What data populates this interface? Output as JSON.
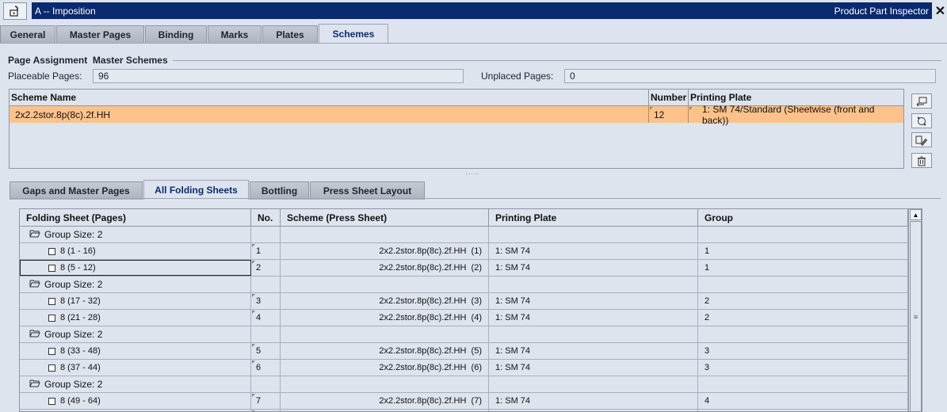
{
  "window": {
    "title": "A -- Imposition",
    "inspector_label": "Product Part Inspector",
    "lock_icon": "lock-open-icon",
    "close_glyph": "✕"
  },
  "main_tabs": [
    {
      "label": "General"
    },
    {
      "label": "Master Pages"
    },
    {
      "label": "Binding"
    },
    {
      "label": "Marks"
    },
    {
      "label": "Plates"
    },
    {
      "label": "Schemes"
    }
  ],
  "page_assignment": {
    "title": "Page Assignment  Master Schemes",
    "placeable_label": "Placeable Pages:",
    "placeable_value": "96",
    "unplaced_label": "Unplaced Pages:",
    "unplaced_value": "0"
  },
  "scheme_table": {
    "headers": [
      "Scheme Name",
      "Number",
      "Printing Plate"
    ],
    "rows": [
      {
        "name": "2x2.2stor.8p(8c).2f.HH",
        "number": "12",
        "plate": "1: SM 74/Standard (Sheetwise (front and back))"
      }
    ]
  },
  "side_buttons": [
    "swap-icon",
    "refresh-icon",
    "edit-icon",
    "trash-icon"
  ],
  "splitter_glyph": "·····",
  "sub_tabs": [
    {
      "label": "Gaps and Master Pages"
    },
    {
      "label": "All Folding Sheets"
    },
    {
      "label": "Bottling"
    },
    {
      "label": "Press Sheet Layout"
    }
  ],
  "folding_table": {
    "headers": [
      "Folding Sheet (Pages)",
      "No.",
      "Scheme (Press Sheet)",
      "Printing Plate",
      "Group"
    ],
    "rows": [
      {
        "type": "group",
        "label": "Group Size: 2"
      },
      {
        "type": "item",
        "pages": "8 (1 - 16)",
        "no": "1",
        "scheme": "2x2.2stor.8p(8c).2f.HH  (1)",
        "plate": "1: SM 74",
        "group": "1"
      },
      {
        "type": "item",
        "pages": "8 (5 - 12)",
        "no": "2",
        "scheme": "2x2.2stor.8p(8c).2f.HH  (2)",
        "plate": "1: SM 74",
        "group": "1"
      },
      {
        "type": "group",
        "label": "Group Size: 2"
      },
      {
        "type": "item",
        "pages": "8 (17 - 32)",
        "no": "3",
        "scheme": "2x2.2stor.8p(8c).2f.HH  (3)",
        "plate": "1: SM 74",
        "group": "2"
      },
      {
        "type": "item",
        "pages": "8 (21 - 28)",
        "no": "4",
        "scheme": "2x2.2stor.8p(8c).2f.HH  (4)",
        "plate": "1: SM 74",
        "group": "2"
      },
      {
        "type": "group",
        "label": "Group Size: 2"
      },
      {
        "type": "item",
        "pages": "8 (33 - 48)",
        "no": "5",
        "scheme": "2x2.2stor.8p(8c).2f.HH  (5)",
        "plate": "1: SM 74",
        "group": "3"
      },
      {
        "type": "item",
        "pages": "8 (37 - 44)",
        "no": "6",
        "scheme": "2x2.2stor.8p(8c).2f.HH  (6)",
        "plate": "1: SM 74",
        "group": "3"
      },
      {
        "type": "group",
        "label": "Group Size: 2"
      },
      {
        "type": "item",
        "pages": "8 (49 - 64)",
        "no": "7",
        "scheme": "2x2.2stor.8p(8c).2f.HH  (7)",
        "plate": "1: SM 74",
        "group": "4"
      },
      {
        "type": "item",
        "pages": "",
        "no": "",
        "scheme": "",
        "plate": "",
        "group": ""
      }
    ]
  },
  "scrollbar": {
    "up_glyph": "▲",
    "grip_glyph": "≡"
  }
}
